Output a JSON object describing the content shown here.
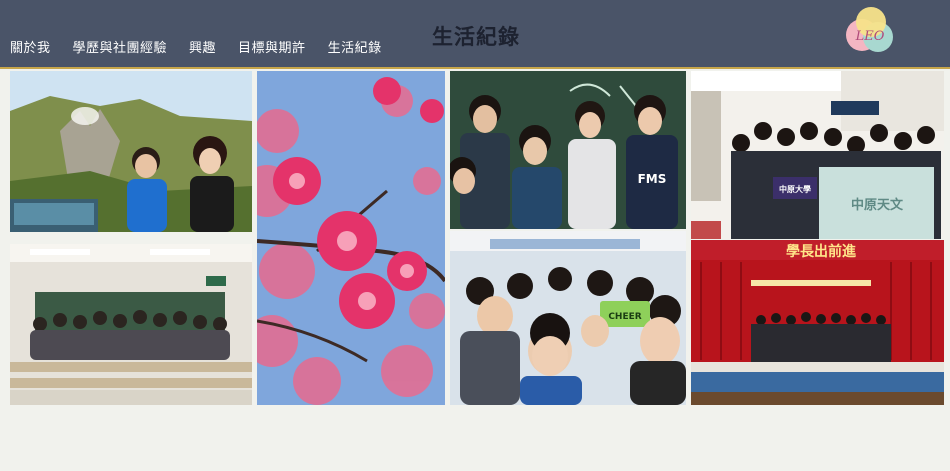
{
  "nav": {
    "items": [
      {
        "label": "關於我"
      },
      {
        "label": "學歷與社團經驗"
      },
      {
        "label": "興趣"
      },
      {
        "label": "目標與期許"
      },
      {
        "label": "生活紀錄"
      }
    ]
  },
  "header": {
    "title": "生活紀錄",
    "logo_text": "LEO"
  },
  "photos": {
    "p4_shirt": "FMS",
    "p5_sign": "CHEER",
    "p6_banner": "中原大學",
    "p6_flag": "中原天文",
    "p7_banner": "學長出前進"
  },
  "colors": {
    "navbar": "#4a5468",
    "accent_border": "#c7a64a",
    "background": "#f1f2ed"
  }
}
